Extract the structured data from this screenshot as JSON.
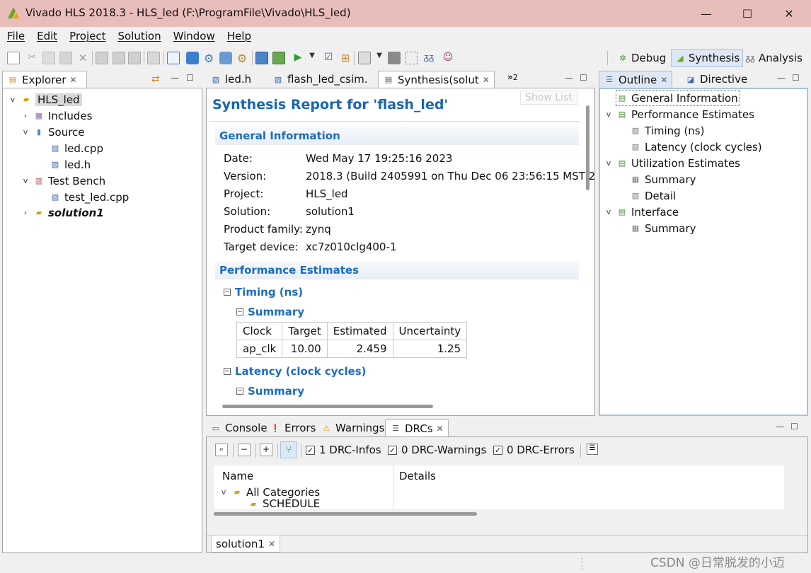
{
  "window": {
    "title": "Vivado HLS 2018.3 - HLS_led (F:\\ProgramFile\\Vivado\\HLS_led)",
    "minimize": "—",
    "maximize": "☐",
    "close": "✕"
  },
  "menu": [
    "File",
    "Edit",
    "Project",
    "Solution",
    "Window",
    "Help"
  ],
  "perspectives": {
    "debug": "Debug",
    "synthesis": "Synthesis",
    "analysis": "Analysis"
  },
  "explorer": {
    "tab": "Explorer",
    "root": "HLS_led",
    "includes": "Includes",
    "source": "Source",
    "source_files": [
      "led.cpp",
      "led.h"
    ],
    "testbench": "Test Bench",
    "testbench_files": [
      "test_led.cpp"
    ],
    "solution": "solution1"
  },
  "editor": {
    "tabs": [
      "led.h",
      "flash_led_csim.",
      "Synthesis(solut"
    ],
    "overflow": "2",
    "show_list": "Show List",
    "report_title": "Synthesis Report for 'flash_led'",
    "general_header": "General Information",
    "general": [
      {
        "k": "Date:",
        "v": "Wed May 17 19:25:16 2023"
      },
      {
        "k": "Version:",
        "v": "2018.3 (Build 2405991 on Thu Dec 06 23:56:15 MST 2"
      },
      {
        "k": "Project:",
        "v": "HLS_led"
      },
      {
        "k": "Solution:",
        "v": "solution1"
      },
      {
        "k": "Product family:",
        "v": "zynq"
      },
      {
        "k": "Target device:",
        "v": "xc7z010clg400-1"
      }
    ],
    "perf_header": "Performance Estimates",
    "timing": "Timing (ns)",
    "summary": "Summary",
    "timing_table": {
      "headers": [
        "Clock",
        "Target",
        "Estimated",
        "Uncertainty"
      ],
      "rows": [
        [
          "ap_clk",
          "10.00",
          "2.459",
          "1.25"
        ]
      ]
    },
    "latency": "Latency (clock cycles)",
    "latency_summary": "Summary"
  },
  "outline": {
    "tabs": [
      "Outline",
      "Directive"
    ],
    "items": [
      {
        "label": "General Information",
        "level": 0,
        "expand": ""
      },
      {
        "label": "Performance Estimates",
        "level": 0,
        "expand": "v"
      },
      {
        "label": "Timing (ns)",
        "level": 1,
        "expand": ""
      },
      {
        "label": "Latency (clock cycles)",
        "level": 1,
        "expand": ""
      },
      {
        "label": "Utilization Estimates",
        "level": 0,
        "expand": "v"
      },
      {
        "label": "Summary",
        "level": 1,
        "expand": ""
      },
      {
        "label": "Detail",
        "level": 1,
        "expand": ""
      },
      {
        "label": "Interface",
        "level": 0,
        "expand": "v"
      },
      {
        "label": "Summary",
        "level": 1,
        "expand": ""
      }
    ]
  },
  "bottom": {
    "tabs": [
      "Console",
      "Errors",
      "Warnings",
      "DRCs"
    ],
    "drc_infos": "1 DRC-Infos",
    "drc_warnings": "0 DRC-Warnings",
    "drc_errors": "0 DRC-Errors",
    "col_name": "Name",
    "col_details": "Details",
    "all_categories": "All Categories",
    "partial_row": "SCHEDULE",
    "solution_tab": "solution1"
  },
  "watermark": "CSDN @日常脱发的小迈",
  "colors": {
    "titlebar": "#e9bdb9",
    "accent_blue": "#1c6cc0",
    "background": "#f0f0f0"
  }
}
